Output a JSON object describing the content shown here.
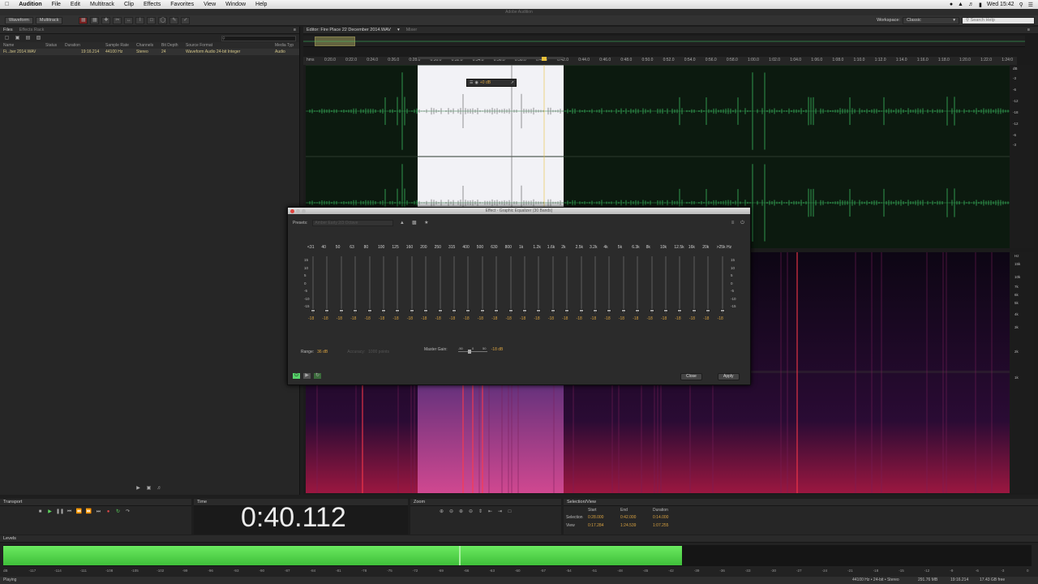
{
  "menubar": {
    "apple": "",
    "app_name": "Audition",
    "items": [
      "File",
      "Edit",
      "Multitrack",
      "Clip",
      "Effects",
      "Favorites",
      "View",
      "Window",
      "Help"
    ],
    "clock": "Wed 15:42"
  },
  "app_title": "Adobe Audition",
  "toolbar": {
    "waveform_label": "Waveform",
    "multitrack_label": "Multitrack",
    "workspace_label": "Workspace:",
    "workspace_value": "Classic",
    "search_placeholder": "Search Help"
  },
  "files_panel": {
    "tab_files": "Files",
    "tab_effects": "Effects Rack",
    "columns": [
      "Name",
      "Status",
      "Duration",
      "Sample Rate",
      "Channels",
      "Bit Depth",
      "Source Format",
      "Media Typ"
    ],
    "row": [
      "Fi...ber 2014.WAV",
      "",
      "19:16.214",
      "44100 Hz",
      "Stereo",
      "24",
      "Waveform Audio 24-bit Integer",
      "Audio"
    ]
  },
  "editor": {
    "tab_editor": "Editor: Fire Place 22 December 2014.WAV",
    "tab_mixer": "Mixer",
    "ruler_unit": "hms",
    "ruler_ticks": [
      "0:20.0",
      "0:22.0",
      "0:24.0",
      "0:26.0",
      "0:28.0",
      "0:30.0",
      "0:32.0",
      "0:34.0",
      "0:36.0",
      "0:38.0",
      "0:40.0",
      "0:42.0",
      "0:44.0",
      "0:46.0",
      "0:48.0",
      "0:50.0",
      "0:52.0",
      "0:54.0",
      "0:56.0",
      "0:58.0",
      "1:00.0",
      "1:02.0",
      "1:04.0",
      "1:06.0",
      "1:08.0",
      "1:10.0",
      "1:12.0",
      "1:14.0",
      "1:16.0",
      "1:18.0",
      "1:20.0",
      "1:22.0",
      "1:24:0"
    ],
    "hud_value": "+0 dB",
    "db_labels": [
      "dB",
      "-3",
      "-6",
      "-12",
      "-18",
      "-12",
      "-6",
      "-3"
    ],
    "hz_labels": [
      "Hz",
      "15k",
      "10k",
      "7k",
      "6k",
      "5k",
      "4k",
      "3k",
      "2k",
      "1k"
    ]
  },
  "eq": {
    "title": "Effect - Graphic Equalizer (30 Bands)",
    "presets_label": "Presets:",
    "presets_value": "Amber Early 2/3 Octave",
    "bands": [
      "<31",
      "40",
      "50",
      "63",
      "80",
      "100",
      "125",
      "160",
      "200",
      "250",
      "315",
      "400",
      "500",
      "630",
      "800",
      "1k",
      "1.2k",
      "1.6k",
      "2k",
      "2.5k",
      "3.2k",
      "4k",
      "5k",
      "6.3k",
      "8k",
      "10k",
      "12.5k",
      "16k",
      "20k",
      ">25k Hz"
    ],
    "gain_value": "-18",
    "scale_left": [
      "15",
      "10",
      "5",
      "0",
      "-5",
      "-10",
      "-15"
    ],
    "scale_right": [
      "15",
      "10",
      "5",
      "0",
      "-5",
      "-10",
      "-15"
    ],
    "range_label": "Range:",
    "range_value": "36 dB",
    "accuracy_label": "Accuracy:",
    "accuracy_value": "1000 points",
    "master_gain_label": "Master Gain:",
    "master_gain_scale_min": "-50",
    "master_gain_scale_mid": "0",
    "master_gain_scale_max": "50",
    "master_gain_value": "-18 dB",
    "close_label": "Close",
    "apply_label": "Apply"
  },
  "transport": {
    "title": "Transport"
  },
  "time": {
    "title": "Time",
    "value": "0:40.112"
  },
  "zoom": {
    "title": "Zoom"
  },
  "selection": {
    "title": "Selection/View",
    "col_start": "Start",
    "col_end": "End",
    "col_duration": "Duration",
    "row_selection": "Selection",
    "row_view": "View",
    "sel_start": "0:28.000",
    "sel_end": "0:42.000",
    "sel_duration": "0:14.000",
    "view_start": "0:17.284",
    "view_end": "1:24.539",
    "view_duration": "1:07.255"
  },
  "levels": {
    "title": "Levels",
    "scale": [
      "dB",
      "-117",
      "-114",
      "-111",
      "-108",
      "-105",
      "-102",
      "-99",
      "-96",
      "-93",
      "-90",
      "-87",
      "-84",
      "-81",
      "-78",
      "-75",
      "-72",
      "-69",
      "-66",
      "-63",
      "-60",
      "-57",
      "-54",
      "-51",
      "-48",
      "-45",
      "-42",
      "-39",
      "-36",
      "-33",
      "-30",
      "-27",
      "-24",
      "-21",
      "-18",
      "-15",
      "-12",
      "-9",
      "-6",
      "-3",
      "0"
    ],
    "level_fraction": 0.66
  },
  "status": {
    "left": "Playing",
    "format": "44100 Hz • 24-bit • Stereo",
    "size": "291.76 MB",
    "duration": "19:16.214",
    "free": "17.43 GB free"
  },
  "colors": {
    "wave": "#3fcf6a",
    "selection": "#f2f2f6",
    "level_green": "#57e04e",
    "time_text": "#ececec",
    "accent_orange": "#d6a040"
  }
}
